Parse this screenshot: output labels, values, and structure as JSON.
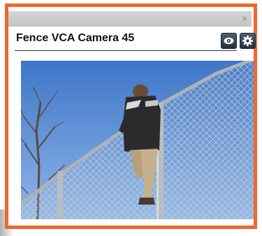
{
  "window": {
    "close_label": "×",
    "title": "Fence VCA Camera 45"
  },
  "toolbar": {
    "view_icon": "eye-icon",
    "settings_icon": "gear-icon"
  },
  "camera": {
    "scene_icon": "camera-feed-image"
  },
  "colors": {
    "accent_border": "#ec6a2c",
    "button_dark": "#2e3a4a",
    "sky": "#5b8fd6"
  }
}
